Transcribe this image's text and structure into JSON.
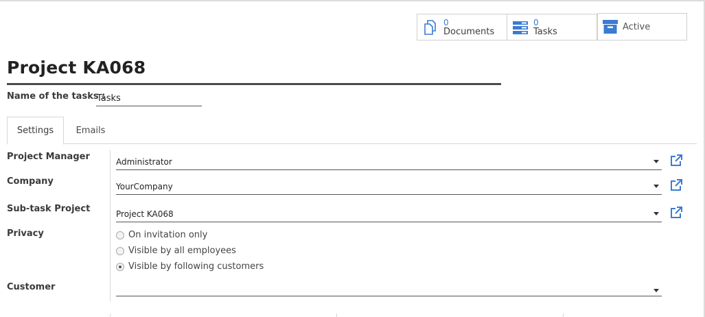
{
  "stat_buttons": {
    "documents": {
      "count": "0",
      "label": "Documents",
      "icon": "documents-icon"
    },
    "tasks": {
      "count": "0",
      "label": "Tasks",
      "icon": "tasks-icon"
    },
    "active": {
      "label": "Active",
      "icon": "archive-box-icon"
    }
  },
  "project": {
    "title": "Project KA068",
    "tasks_name_label": "Name of the tasks :",
    "tasks_name_value": "Tasks"
  },
  "tabs": [
    {
      "label": "Settings",
      "active": true
    },
    {
      "label": "Emails",
      "active": false
    }
  ],
  "fields": {
    "project_manager": {
      "label": "Project Manager",
      "value": "Administrator"
    },
    "company": {
      "label": "Company",
      "value": "YourCompany"
    },
    "subtask_project": {
      "label": "Sub-task Project",
      "value": "Project KA068"
    },
    "privacy": {
      "label": "Privacy",
      "options": [
        {
          "label": "On invitation only",
          "checked": false
        },
        {
          "label": "Visible by all employees",
          "checked": false
        },
        {
          "label": "Visible by following customers",
          "checked": true
        }
      ]
    },
    "customer": {
      "label": "Customer",
      "value": ""
    }
  },
  "colors": {
    "accent": "#3b7bd3",
    "title_rule": "#4a4a4a"
  }
}
